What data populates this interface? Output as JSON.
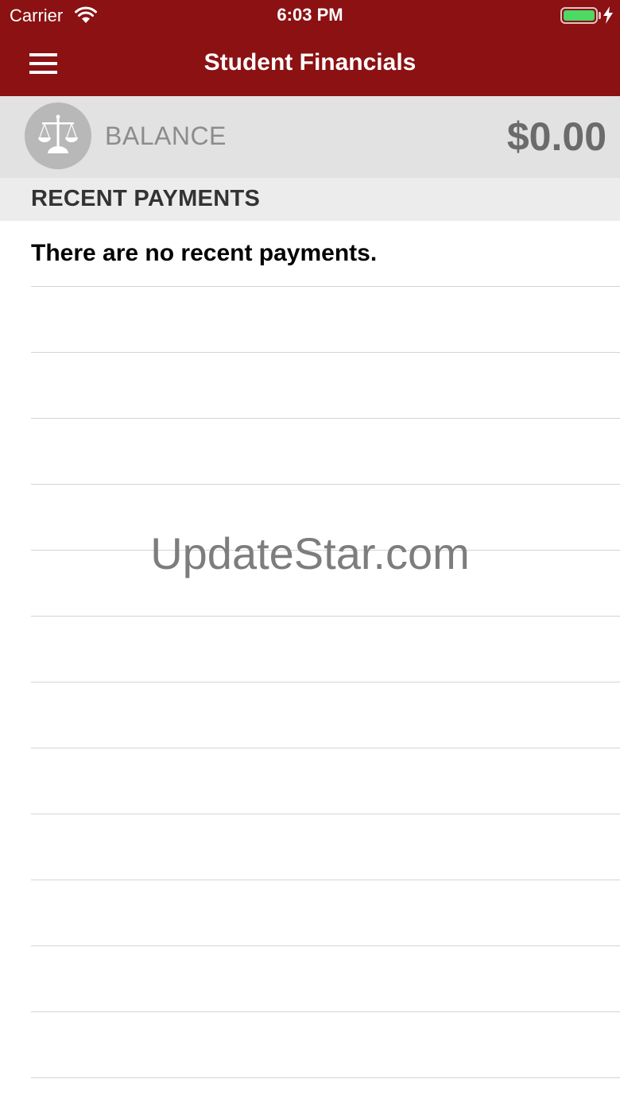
{
  "status_bar": {
    "carrier": "Carrier",
    "time": "6:03 PM",
    "wifi_icon": "wifi-icon",
    "battery_icon": "battery-icon",
    "charging_icon": "charging-bolt-icon",
    "battery_color": "#4cd964"
  },
  "nav_bar": {
    "title": "Student Financials",
    "menu_icon": "hamburger-menu-icon",
    "background_color": "#8b1113"
  },
  "balance": {
    "icon": "scales-icon",
    "label": "BALANCE",
    "amount": "$0.00"
  },
  "recent_payments": {
    "header": "RECENT PAYMENTS",
    "empty_message": "There are no recent payments."
  },
  "watermark": "UpdateStar.com"
}
